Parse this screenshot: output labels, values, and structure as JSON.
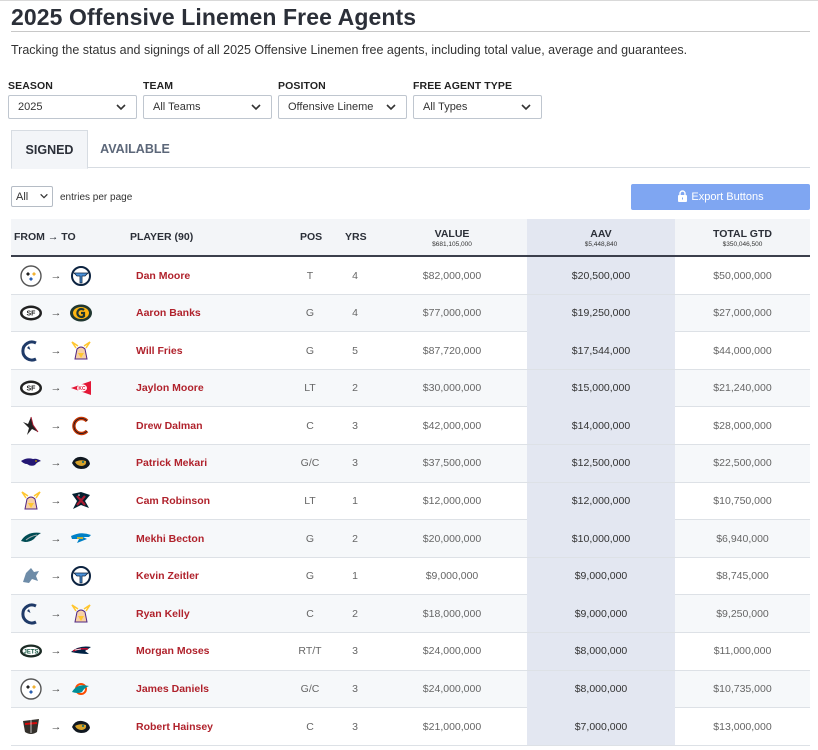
{
  "page": {
    "title": "2025 Offensive Linemen Free Agents",
    "subtitle": "Tracking the status and signings of all 2025 Offensive Linemen free agents, including total value, average and guarantees."
  },
  "filters": [
    {
      "label": "SEASON",
      "value": "2025"
    },
    {
      "label": "TEAM",
      "value": "All Teams"
    },
    {
      "label": "POSITON",
      "value": "Offensive Lineme"
    },
    {
      "label": "FREE AGENT TYPE",
      "value": "All Types"
    }
  ],
  "tabs": [
    {
      "label": "SIGNED",
      "active": true
    },
    {
      "label": "AVAILABLE",
      "active": false
    }
  ],
  "table_controls": {
    "page_length": "All",
    "page_length_suffix": "entries per page",
    "export_label": "Export Buttons"
  },
  "columns": {
    "from_to": "FROM",
    "to": "TO",
    "player": "PLAYER (90)",
    "pos": "POS",
    "yrs": "YRS",
    "value": "VALUE",
    "value_total": "$681,105,000",
    "aav": "AAV",
    "aav_total": "$5,448,840",
    "gtd": "TOTAL GTD",
    "gtd_total": "$350,046,500"
  },
  "colors": {
    "player_link": "#b0222c",
    "export_button": "#7fa6f2",
    "aav_band": "#e3e7f1"
  },
  "rows": [
    {
      "from": "steelers-logo",
      "to": "titans-logo",
      "player": "Dan Moore",
      "pos": "T",
      "yrs": "4",
      "value": "$82,000,000",
      "aav": "$20,500,000",
      "gtd": "$50,000,000"
    },
    {
      "from": "49ers-logo",
      "to": "packers-logo",
      "player": "Aaron Banks",
      "pos": "G",
      "yrs": "4",
      "value": "$77,000,000",
      "aav": "$19,250,000",
      "gtd": "$27,000,000"
    },
    {
      "from": "colts-logo",
      "to": "vikings-logo",
      "player": "Will Fries",
      "pos": "G",
      "yrs": "5",
      "value": "$87,720,000",
      "aav": "$17,544,000",
      "gtd": "$44,000,000"
    },
    {
      "from": "49ers-logo",
      "to": "chiefs-logo",
      "player": "Jaylon Moore",
      "pos": "LT",
      "yrs": "2",
      "value": "$30,000,000",
      "aav": "$15,000,000",
      "gtd": "$21,240,000"
    },
    {
      "from": "falcons-logo",
      "to": "bears-logo",
      "player": "Drew Dalman",
      "pos": "C",
      "yrs": "3",
      "value": "$42,000,000",
      "aav": "$14,000,000",
      "gtd": "$28,000,000"
    },
    {
      "from": "ravens-logo",
      "to": "jaguars-logo",
      "player": "Patrick Mekari",
      "pos": "G/C",
      "yrs": "3",
      "value": "$37,500,000",
      "aav": "$12,500,000",
      "gtd": "$22,500,000"
    },
    {
      "from": "vikings-logo",
      "to": "texans-logo",
      "player": "Cam Robinson",
      "pos": "LT",
      "yrs": "1",
      "value": "$12,000,000",
      "aav": "$12,000,000",
      "gtd": "$10,750,000"
    },
    {
      "from": "eagles-logo",
      "to": "chargers-logo",
      "player": "Mekhi Becton",
      "pos": "G",
      "yrs": "2",
      "value": "$20,000,000",
      "aav": "$10,000,000",
      "gtd": "$6,940,000"
    },
    {
      "from": "lions-logo",
      "to": "titans-logo",
      "player": "Kevin Zeitler",
      "pos": "G",
      "yrs": "1",
      "value": "$9,000,000",
      "aav": "$9,000,000",
      "gtd": "$8,745,000"
    },
    {
      "from": "colts-logo",
      "to": "vikings-logo",
      "player": "Ryan Kelly",
      "pos": "C",
      "yrs": "2",
      "value": "$18,000,000",
      "aav": "$9,000,000",
      "gtd": "$9,250,000"
    },
    {
      "from": "jets-logo",
      "to": "patriots-logo",
      "player": "Morgan Moses",
      "pos": "RT/T",
      "yrs": "3",
      "value": "$24,000,000",
      "aav": "$8,000,000",
      "gtd": "$11,000,000"
    },
    {
      "from": "steelers-logo",
      "to": "dolphins-logo",
      "player": "James Daniels",
      "pos": "G/C",
      "yrs": "3",
      "value": "$24,000,000",
      "aav": "$8,000,000",
      "gtd": "$10,735,000"
    },
    {
      "from": "buccaneers-logo",
      "to": "jaguars-logo",
      "player": "Robert Hainsey",
      "pos": "C",
      "yrs": "3",
      "value": "$21,000,000",
      "aav": "$7,000,000",
      "gtd": "$13,000,000"
    }
  ]
}
